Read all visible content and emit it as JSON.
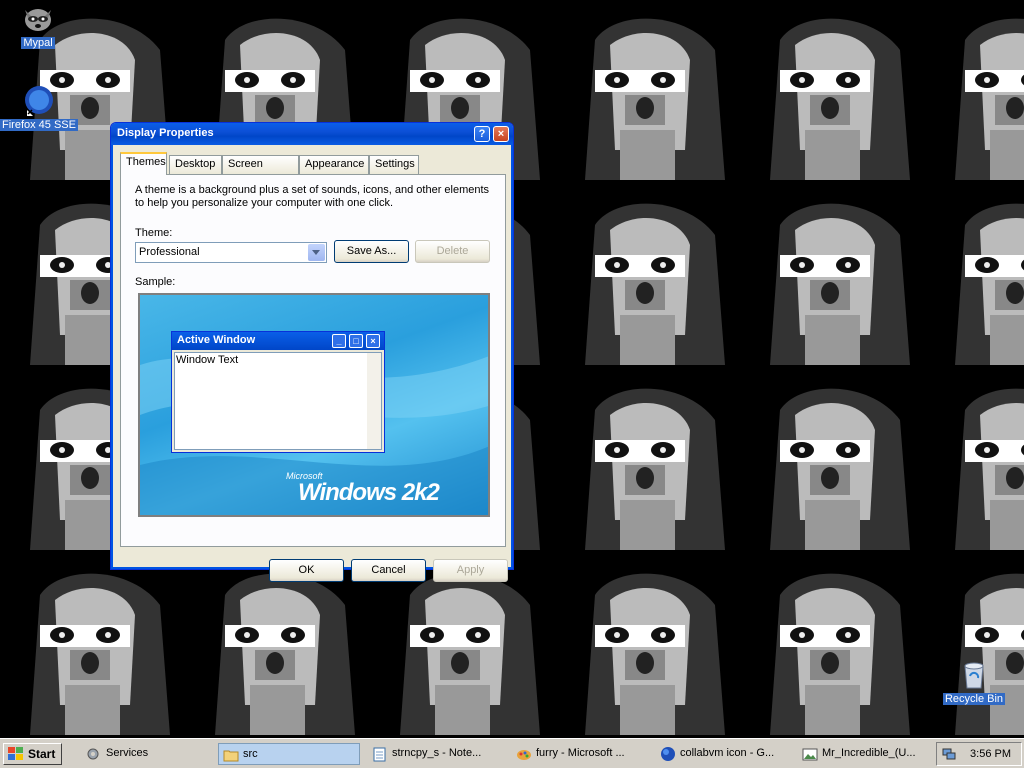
{
  "desktop": {
    "icons": [
      {
        "label": "Mypal",
        "icon": "raccoon-icon"
      },
      {
        "label": "Firefox 45 SSE",
        "icon": "firefox-icon"
      },
      {
        "label": "Recycle Bin",
        "icon": "recycle-bin-icon"
      }
    ]
  },
  "dialog": {
    "title": "Display Properties",
    "help_button": "?",
    "close_button": "×",
    "tabs": [
      "Themes",
      "Desktop",
      "Screen Saver",
      "Appearance",
      "Settings"
    ],
    "active_tab": "Themes",
    "description": "A theme is a background plus a set of sounds, icons, and other elements to help you personalize your computer with one click.",
    "theme_label": "Theme:",
    "theme_value": "Professional",
    "save_as_label": "Save As...",
    "delete_label": "Delete",
    "sample_label": "Sample:",
    "sample": {
      "window_title": "Active Window",
      "window_text": "Window Text",
      "logo_small": "Microsoft",
      "logo_big": "Windows 2k2"
    },
    "ok_label": "OK",
    "cancel_label": "Cancel",
    "apply_label": "Apply"
  },
  "taskbar": {
    "start_label": "Start",
    "items": [
      {
        "label": "Services",
        "icon": "gears-icon"
      },
      {
        "label": "src",
        "icon": "folder-icon"
      },
      {
        "label": "strncpy_s - Note...",
        "icon": "notepad-icon"
      },
      {
        "label": "furry - Microsoft ...",
        "icon": "paint-icon"
      },
      {
        "label": "collabvm icon - G...",
        "icon": "globe-icon"
      },
      {
        "label": "Mr_Incredible_(U...",
        "icon": "image-icon"
      }
    ],
    "clock": "3:56 PM"
  },
  "colors": {
    "accent": "#0054e3",
    "selection": "#316ac5",
    "dialog_bg": "#ece9d8",
    "sample_bg": "#2a9fdd"
  }
}
